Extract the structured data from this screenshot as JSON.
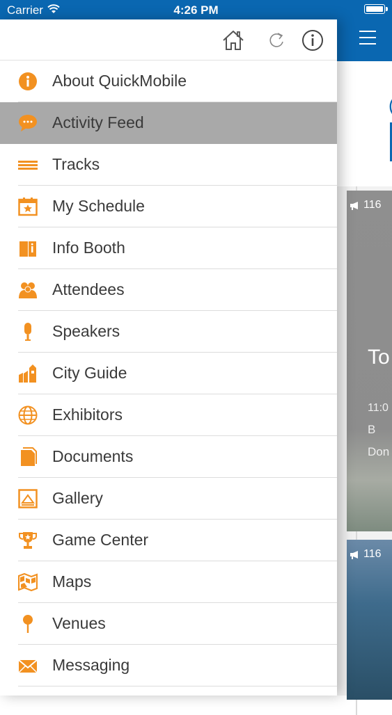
{
  "status_bar": {
    "carrier": "Carrier",
    "time": "4:26 PM"
  },
  "drawer": {
    "menu": [
      {
        "label": "About QuickMobile",
        "icon": "info-circle-icon",
        "active": false
      },
      {
        "label": "Activity Feed",
        "icon": "chat-bubble-icon",
        "active": true
      },
      {
        "label": "Tracks",
        "icon": "tracks-lines-icon",
        "active": false
      },
      {
        "label": "My Schedule",
        "icon": "calendar-star-icon",
        "active": false
      },
      {
        "label": "Info Booth",
        "icon": "info-booth-icon",
        "active": false
      },
      {
        "label": "Attendees",
        "icon": "people-icon",
        "active": false
      },
      {
        "label": "Speakers",
        "icon": "microphone-icon",
        "active": false
      },
      {
        "label": "City Guide",
        "icon": "city-icon",
        "active": false
      },
      {
        "label": "Exhibitors",
        "icon": "globe-icon",
        "active": false
      },
      {
        "label": "Documents",
        "icon": "document-icon",
        "active": false
      },
      {
        "label": "Gallery",
        "icon": "picture-icon",
        "active": false
      },
      {
        "label": "Game Center",
        "icon": "trophy-icon",
        "active": false
      },
      {
        "label": "Maps",
        "icon": "map-icon",
        "active": false
      },
      {
        "label": "Venues",
        "icon": "pin-icon",
        "active": false
      },
      {
        "label": "Messaging",
        "icon": "envelope-icon",
        "active": false
      }
    ]
  },
  "background_feed": {
    "card1": {
      "count": "116",
      "title": "To Fu",
      "time": "11:0",
      "room": "B",
      "desc": "Don Futu his v"
    },
    "card2": {
      "count": "116"
    }
  },
  "colors": {
    "brand_blue": "#0a67b1",
    "accent_orange": "#f29121",
    "active_row": "#a9a9a9"
  }
}
